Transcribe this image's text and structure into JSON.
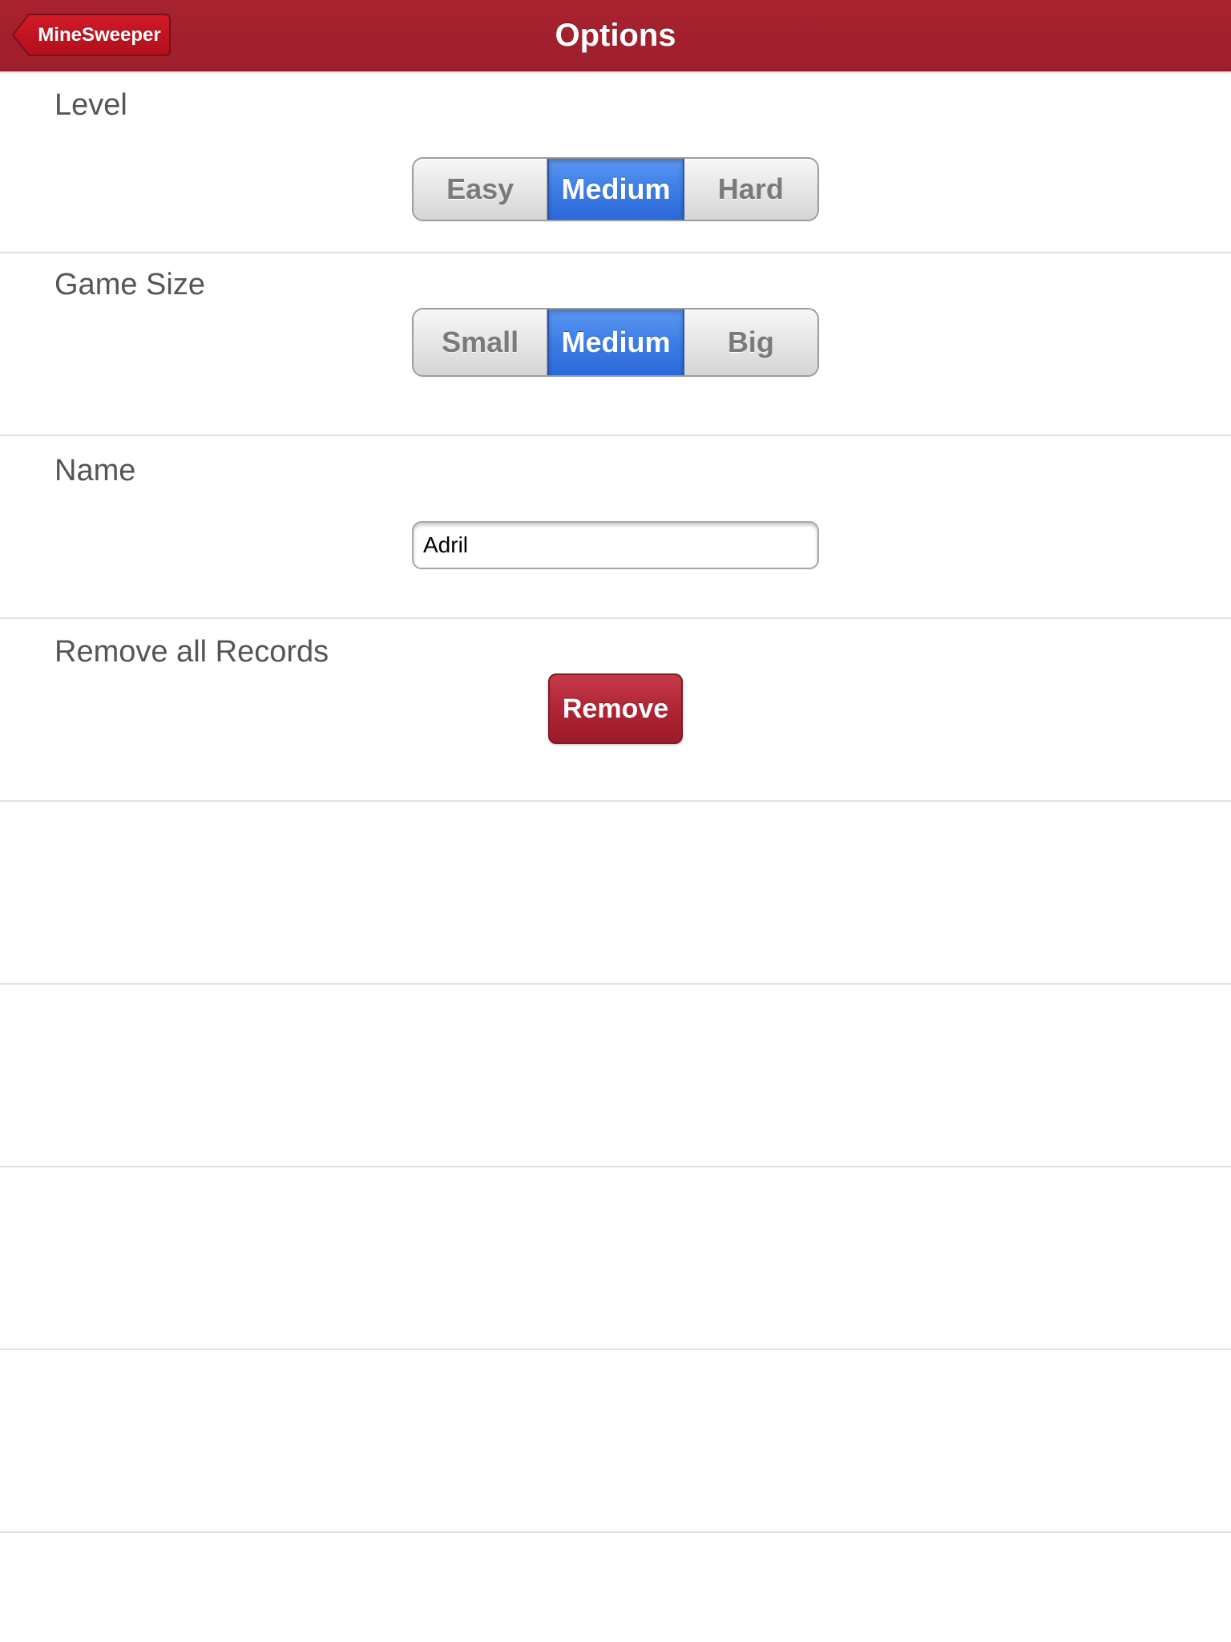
{
  "navbar": {
    "title": "Options",
    "back_label": "MineSweeper",
    "color": "#a3222f"
  },
  "level": {
    "label": "Level",
    "options": [
      "Easy",
      "Medium",
      "Hard"
    ],
    "selected": "Medium"
  },
  "game_size": {
    "label": "Game Size",
    "options": [
      "Small",
      "Medium",
      "Big"
    ],
    "selected": "Medium"
  },
  "name": {
    "label": "Name",
    "value": "Adril"
  },
  "records": {
    "label": "Remove all Records",
    "button_label": "Remove",
    "button_color": "#b02535"
  },
  "selected_segment_color": "#3d7de6"
}
